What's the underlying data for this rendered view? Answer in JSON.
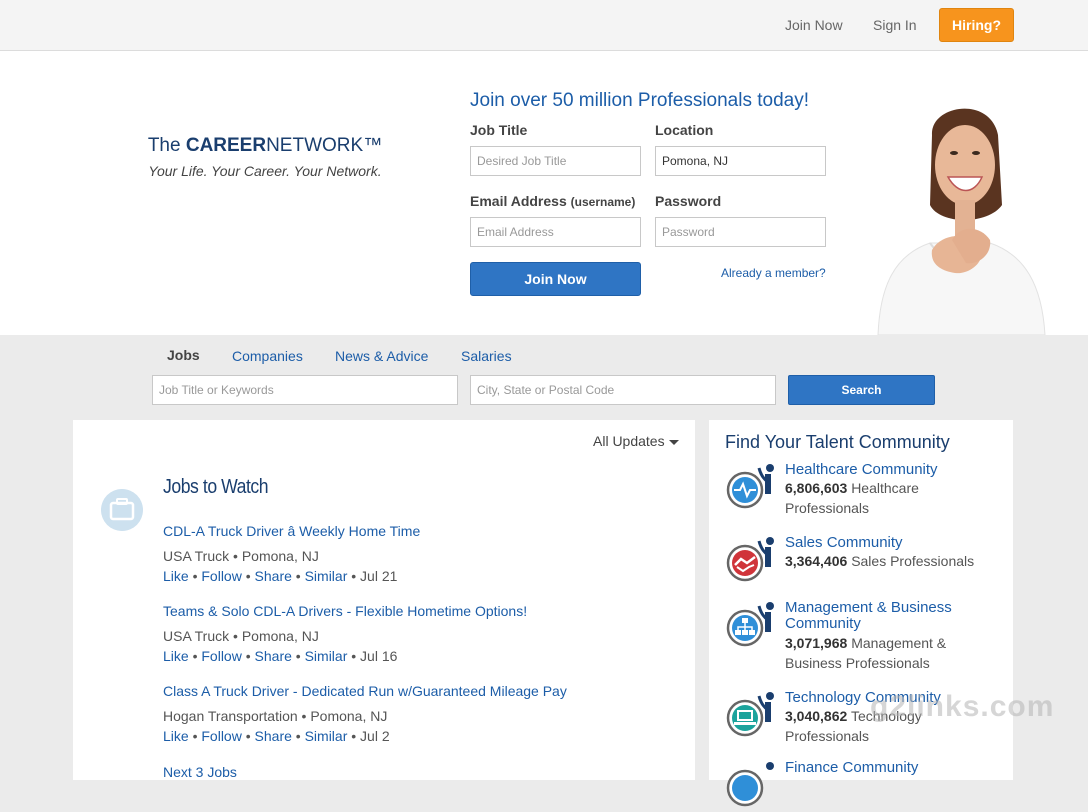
{
  "topbar": {
    "join_now": "Join Now",
    "sign_in": "Sign In",
    "hiring": "Hiring?"
  },
  "brand": {
    "the": "The",
    "career": "CAREER",
    "network": "NETWORK",
    "tm": "™",
    "tagline": "Your Life. Your Career. Your Network."
  },
  "signup": {
    "headline": "Join over 50 million Professionals today!",
    "job_title_label": "Job Title",
    "job_title_placeholder": "Desired Job Title",
    "location_label": "Location",
    "location_value": "Pomona, NJ",
    "email_label": "Email Address",
    "email_label_small": "(username)",
    "email_placeholder": "Email Address",
    "password_label": "Password",
    "password_placeholder": "Password",
    "join_button": "Join Now",
    "already_member": "Already a member?"
  },
  "search": {
    "tabs": [
      "Jobs",
      "Companies",
      "News & Advice",
      "Salaries"
    ],
    "keywords_placeholder": "Job Title or Keywords",
    "location_placeholder": "City, State or Postal Code",
    "search_button": "Search"
  },
  "feed": {
    "filter": "All Updates",
    "title": "Jobs to Watch",
    "jobs": [
      {
        "title": "CDL-A Truck Driver â Weekly Home Time",
        "company": "USA Truck",
        "location": "Pomona, NJ",
        "date": "Jul 21"
      },
      {
        "title": "Teams & Solo CDL-A Drivers - Flexible Hometime Options!",
        "company": "USA Truck",
        "location": "Pomona, NJ",
        "date": "Jul 16"
      },
      {
        "title": "Class A Truck Driver - Dedicated Run w/Guaranteed Mileage Pay",
        "company": "Hogan Transportation",
        "location": "Pomona, NJ",
        "date": "Jul 2"
      }
    ],
    "actions": {
      "like": "Like",
      "follow": "Follow",
      "share": "Share",
      "similar": "Similar"
    },
    "next": "Next 3 Jobs"
  },
  "communities": {
    "title": "Find Your Talent Community",
    "items": [
      {
        "name": "Healthcare Community",
        "count": "6,806,603",
        "label": "Healthcare Professionals",
        "icon": "heartbeat-icon",
        "color": "#2f8fd8"
      },
      {
        "name": "Sales Community",
        "count": "3,364,406",
        "label": "Sales Professionals",
        "icon": "handshake-icon",
        "color": "#d0343a"
      },
      {
        "name": "Management & Business Community",
        "count": "3,071,968",
        "label": "Management & Business Professionals",
        "icon": "org-chart-icon",
        "color": "#2f8fd8"
      },
      {
        "name": "Technology Community",
        "count": "3,040,862",
        "label": "Technology Professionals",
        "icon": "laptop-icon",
        "color": "#1ba39c"
      },
      {
        "name": "Finance Community",
        "count": "",
        "label": "",
        "icon": "finance-icon",
        "color": "#2f8fd8"
      }
    ]
  },
  "watermark": "g2links.com"
}
